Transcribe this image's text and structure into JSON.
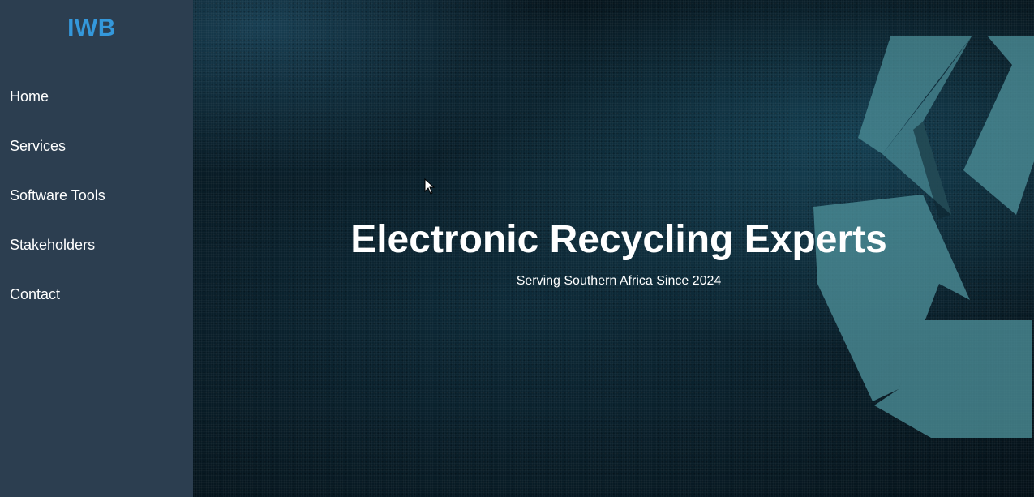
{
  "sidebar": {
    "logo": "IWB",
    "items": [
      {
        "label": "Home"
      },
      {
        "label": "Services"
      },
      {
        "label": "Software Tools"
      },
      {
        "label": "Stakeholders"
      },
      {
        "label": "Contact"
      }
    ]
  },
  "hero": {
    "title": "Electronic Recycling Experts",
    "subtitle": "Serving Southern Africa Since 2024",
    "icon": "recycle-icon"
  },
  "colors": {
    "sidebar_bg": "#2c3e50",
    "logo": "#3498db",
    "nav_text": "#ffffff",
    "hero_text": "#ffffff",
    "recycle_mark": "#4a8f9c"
  }
}
